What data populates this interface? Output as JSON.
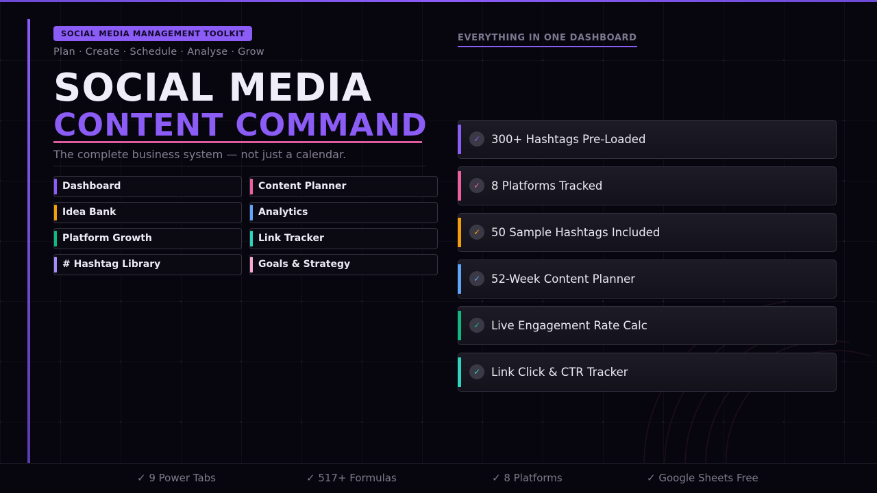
{
  "header": {
    "badge": "SOCIAL MEDIA MANAGEMENT TOOLKIT",
    "tagline": "Plan · Create · Schedule · Analyse · Grow",
    "title_line1": "SOCIAL MEDIA",
    "title_line2": "CONTENT COMMAND",
    "subtitle": "The complete business system — not just a calendar."
  },
  "tabs": [
    {
      "label": " Dashboard",
      "color": "#8b5cf6"
    },
    {
      "label": " Content Planner",
      "color": "#ec5fa0"
    },
    {
      "label": " Idea Bank",
      "color": "#f59e0b"
    },
    {
      "label": " Analytics",
      "color": "#60a5fa"
    },
    {
      "label": " Platform Growth",
      "color": "#10b981"
    },
    {
      "label": " Link Tracker",
      "color": "#2dd4bf"
    },
    {
      "label": "# Hashtag Library",
      "color": "#a78bfa"
    },
    {
      "label": " Goals & Strategy",
      "color": "#f9a8d4"
    }
  ],
  "features": {
    "heading": "EVERYTHING IN ONE DASHBOARD",
    "items": [
      {
        "text": "300+ Hashtags Pre-Loaded",
        "color": "#8b5cf6",
        "check": "✓"
      },
      {
        "text": "8 Platforms Tracked",
        "color": "#ec5fa0",
        "check": "✓"
      },
      {
        "text": "50 Sample Hashtags Included",
        "color": "#f59e0b",
        "check": "✓"
      },
      {
        "text": "52-Week Content Planner",
        "color": "#60a5fa",
        "check": "✓"
      },
      {
        "text": "Live Engagement Rate Calc",
        "color": "#10b981",
        "check": "✓"
      },
      {
        "text": "Link Click & CTR Tracker",
        "color": "#2dd4bf",
        "check": "✓"
      }
    ]
  },
  "footer": {
    "items": [
      "✓ 9 Power Tabs",
      "✓ 517+ Formulas",
      "✓ 8 Platforms",
      "✓ Google Sheets Free"
    ]
  }
}
